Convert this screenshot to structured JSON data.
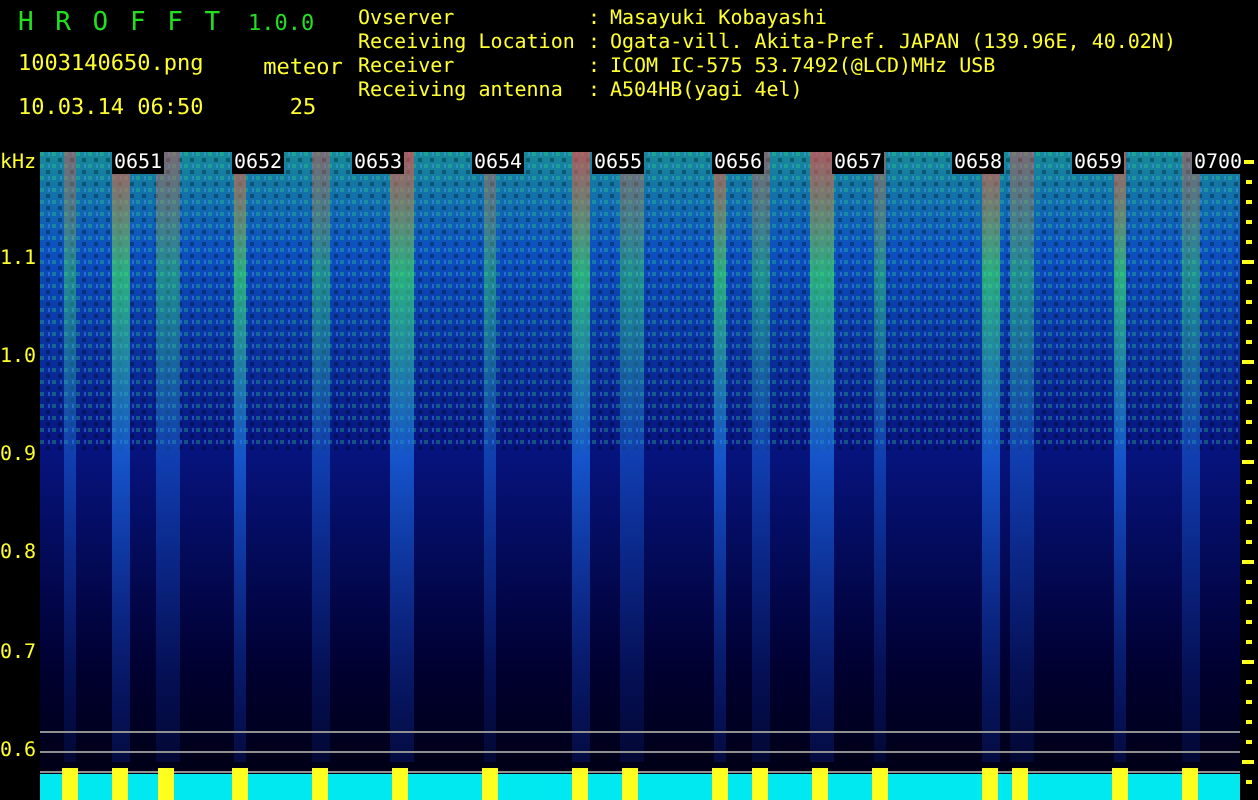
{
  "app": {
    "title": "H R O F F T",
    "version": "1.0.0"
  },
  "file_name": "1003140650.png",
  "datetime": "10.03.14 06:50",
  "meteor": {
    "label": "meteor",
    "count": "25"
  },
  "info": [
    {
      "label": "Ovserver",
      "separator": ":",
      "value": "Masayuki Kobayashi"
    },
    {
      "label": "Receiving Location",
      "separator": ":",
      "value": "Ogata-vill. Akita-Pref. JAPAN (139.96E, 40.02N)"
    },
    {
      "label": "Receiver",
      "separator": ":",
      "value": "ICOM IC-575 53.7492(@LCD)MHz USB"
    },
    {
      "label": "Receiving antenna",
      "separator": ":",
      "value": "A504HB(yagi 4el)"
    }
  ],
  "spectrogram": {
    "unit": "kHz",
    "y_labels": [
      "1.1",
      "1.0",
      "0.9",
      "0.8",
      "0.7",
      "0.6"
    ],
    "time_labels": [
      "0651",
      "0652",
      "0653",
      "0654",
      "0655",
      "0656",
      "0657",
      "0658",
      "0659",
      "0700"
    ]
  }
}
